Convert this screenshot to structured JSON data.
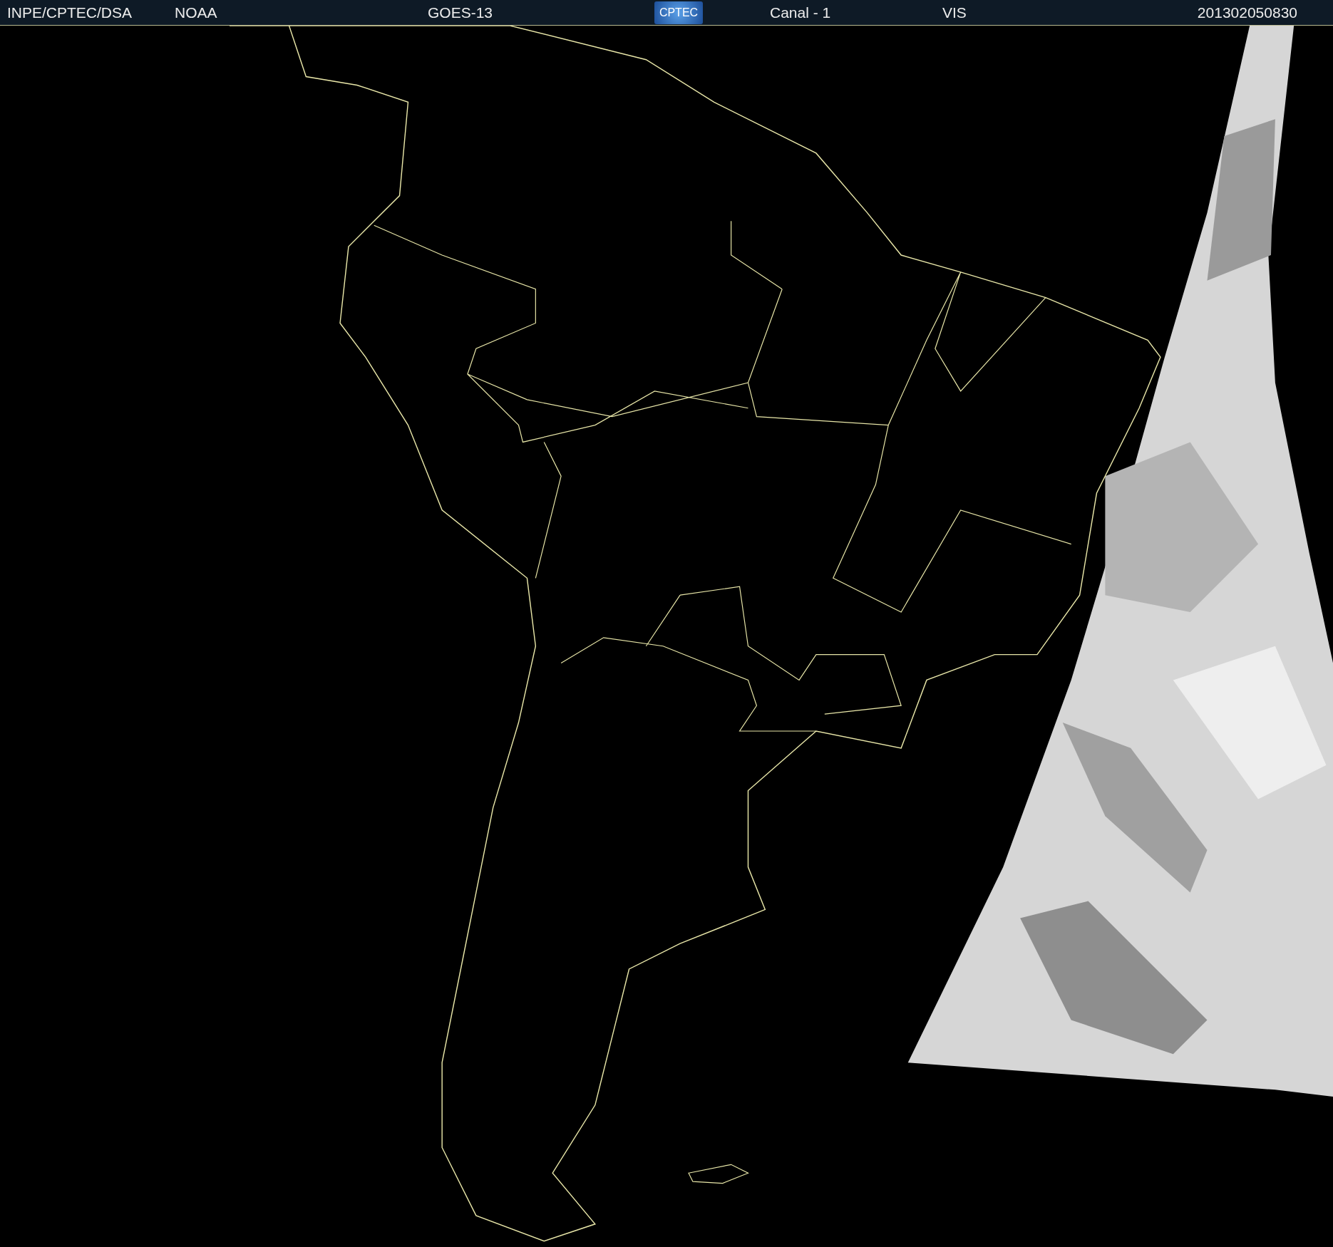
{
  "header": {
    "source": "INPE/CPTEC/DSA",
    "agency": "NOAA",
    "satellite": "GOES-13",
    "logo": "CPTEC",
    "channel": "Canal - 1",
    "band": "VIS",
    "timestamp": "201302050830"
  }
}
